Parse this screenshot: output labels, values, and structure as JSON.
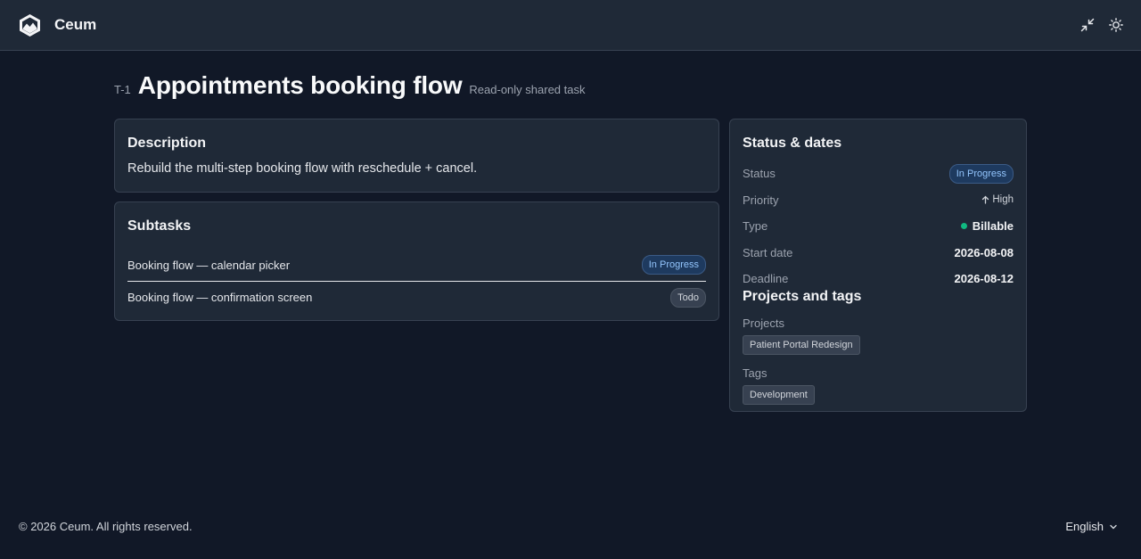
{
  "app": {
    "name": "Ceum"
  },
  "header": {
    "task_key": "T-1",
    "title": "Appointments booking flow",
    "subtitle": "Read-only shared task"
  },
  "description": {
    "heading": "Description",
    "text": "Rebuild the multi-step booking flow with reschedule + cancel."
  },
  "subtasks": {
    "heading": "Subtasks",
    "items": [
      {
        "title": "Booking flow — calendar picker",
        "status": "In Progress"
      },
      {
        "title": "Booking flow — confirmation screen",
        "status": "Todo"
      }
    ]
  },
  "status_dates": {
    "heading": "Status & dates",
    "status_label": "Status",
    "status_value": "In Progress",
    "priority_label": "Priority",
    "priority_value": "High",
    "type_label": "Type",
    "type_value": "Billable",
    "start_label": "Start date",
    "start_value": "2026-08-08",
    "deadline_label": "Deadline",
    "deadline_value": "2026-08-12"
  },
  "projects_tags": {
    "heading": "Projects and tags",
    "projects_label": "Projects",
    "projects": [
      "Patient Portal Redesign"
    ],
    "tags_label": "Tags",
    "tags": [
      "Development"
    ]
  },
  "footer": {
    "copyright": "© 2026 Ceum. All rights reserved.",
    "language": "English"
  },
  "icons": {
    "logo": "ceum-logo-icon",
    "collapse": "minimize-icon",
    "theme": "sun-icon",
    "priority": "arrow-up-icon",
    "language": "chevron-down-icon"
  },
  "colors": {
    "background": "#111827",
    "card": "#1f2937",
    "accent_blue": "#93c5fd",
    "billable_green": "#10b981"
  }
}
